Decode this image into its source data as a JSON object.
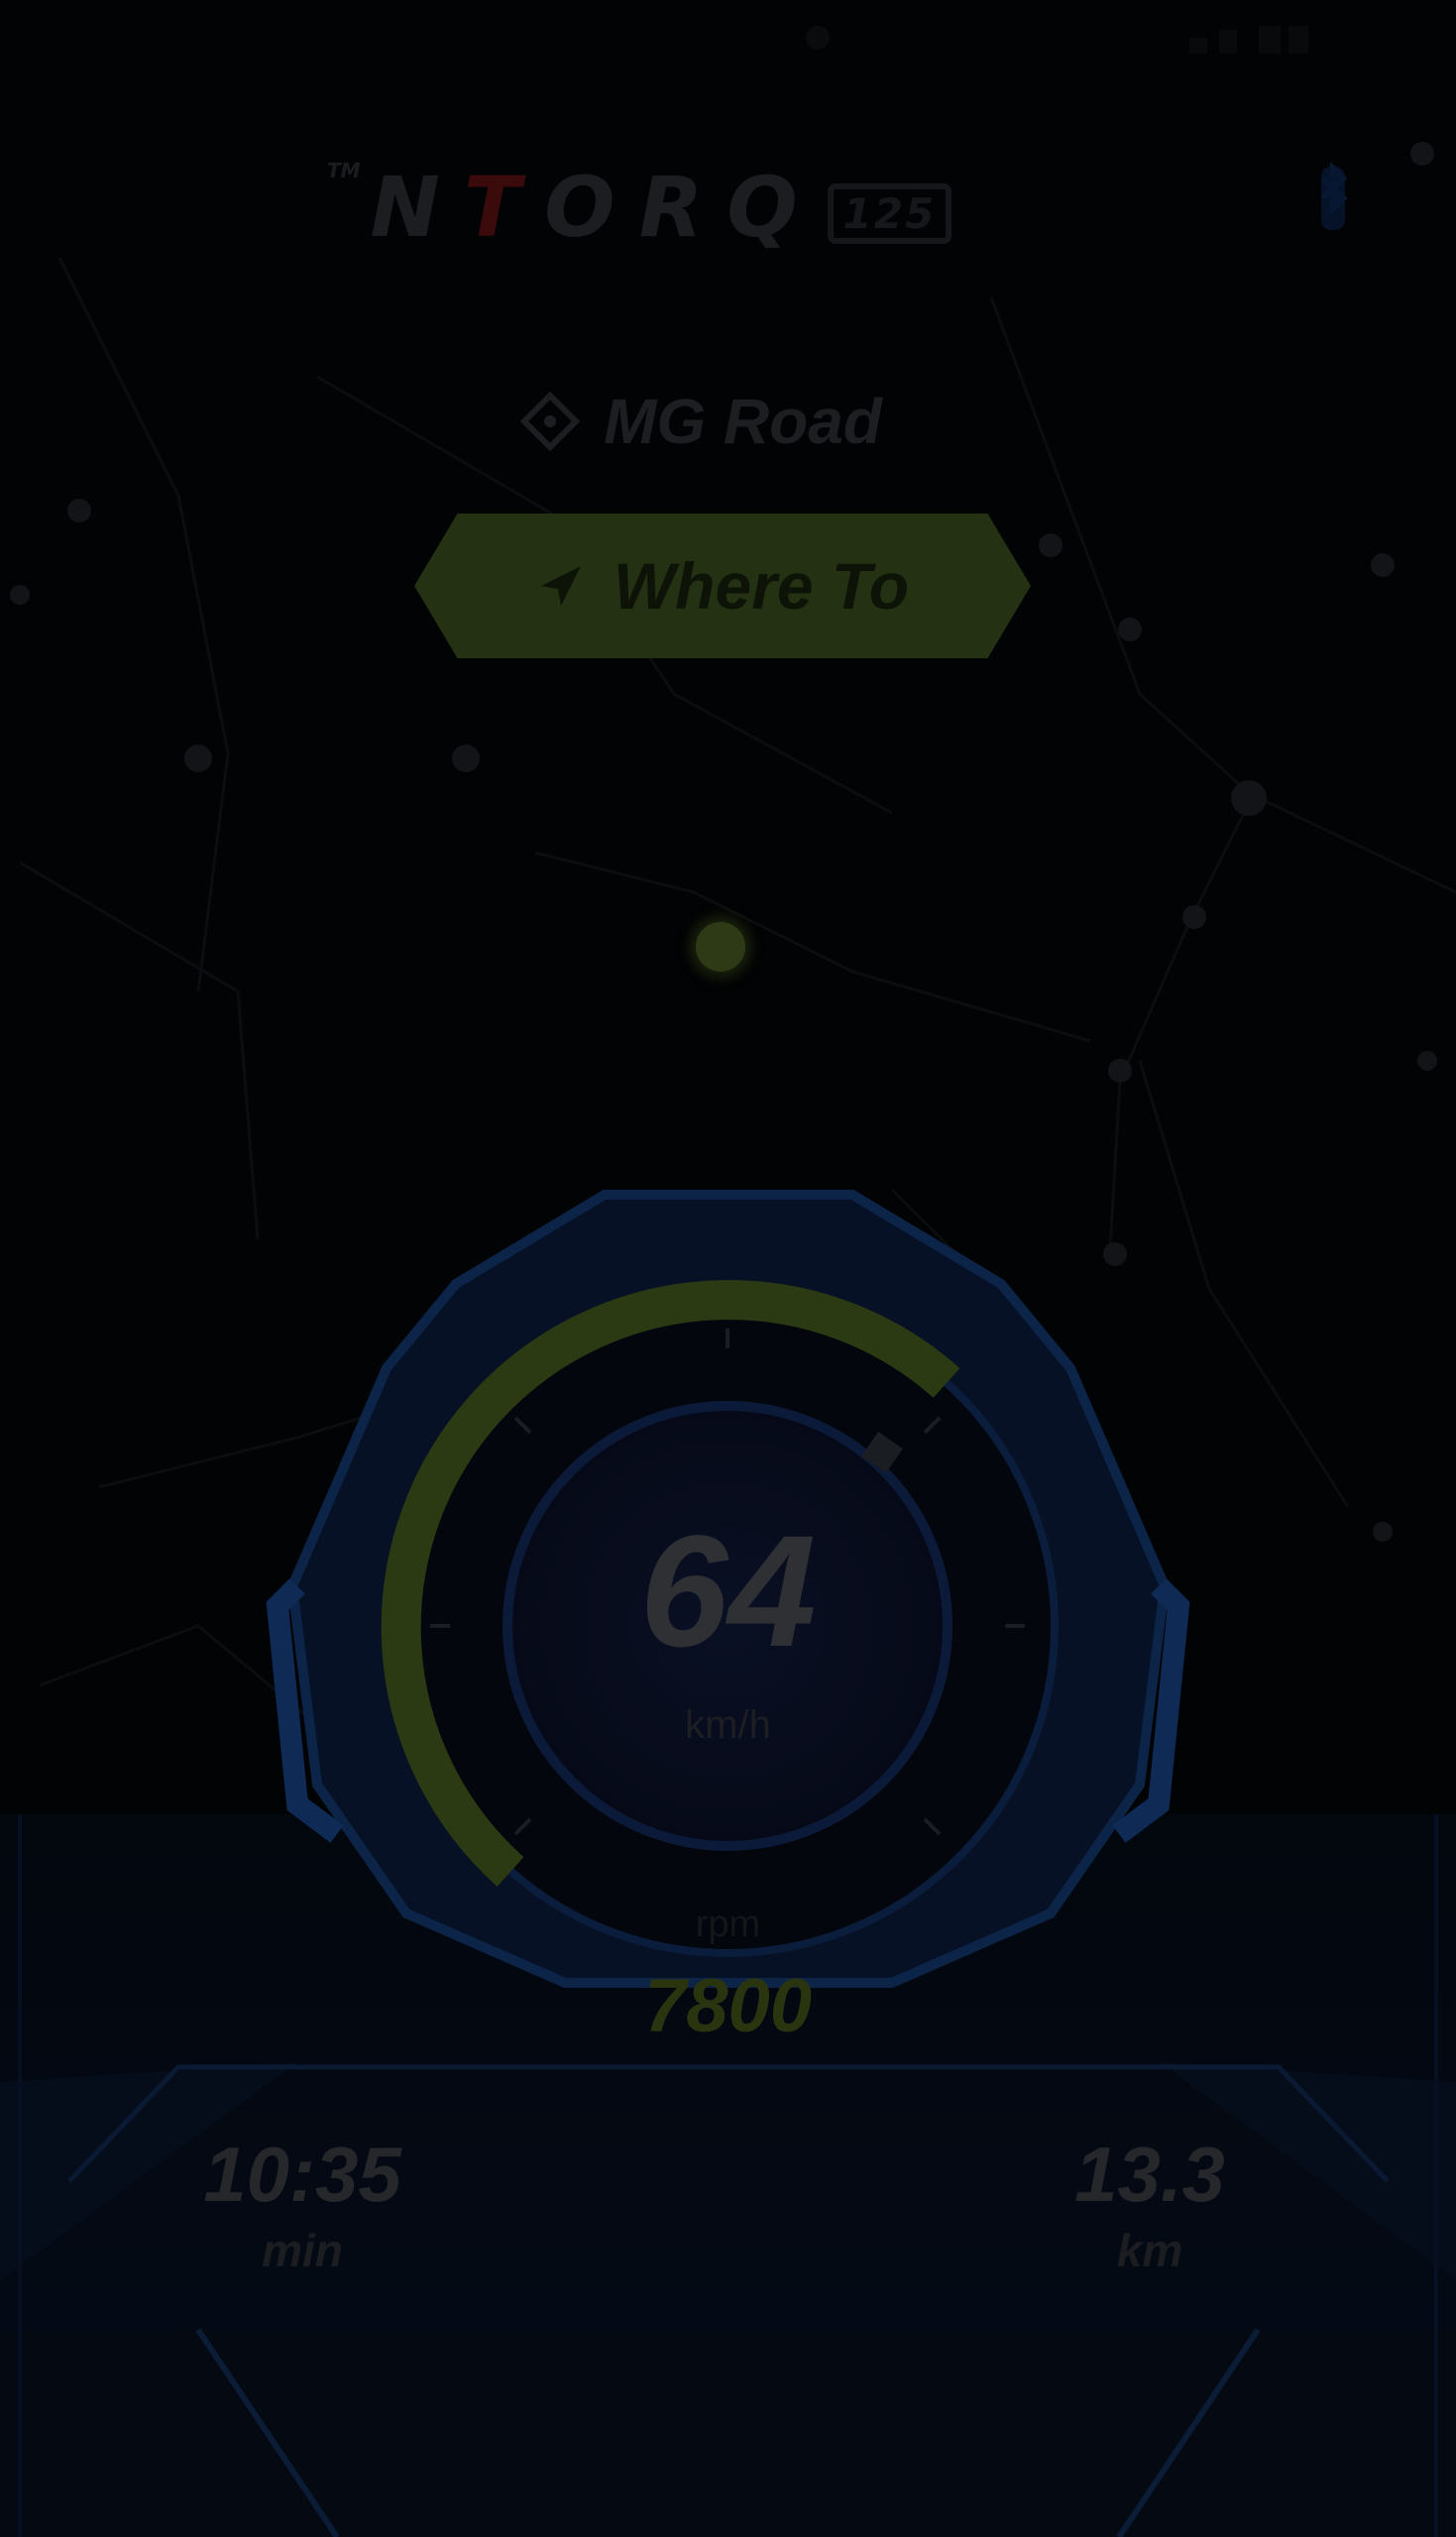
{
  "brand": {
    "tm": "TM",
    "part1": "N",
    "part2": "T",
    "part3": "ORQ",
    "suffix": "125"
  },
  "location": {
    "name": "MG Road"
  },
  "where_to": {
    "label": "Where To"
  },
  "speedometer": {
    "speed": "64",
    "unit": "km/h",
    "rpm_label": "rpm",
    "rpm": "7800",
    "rpm_level": 0.6
  },
  "stats": {
    "time_value": "10:35",
    "time_unit": "min",
    "distance_value": "13.3",
    "distance_unit": "km"
  },
  "colors": {
    "accent_green": "#2c3a13",
    "frame_blue": "#0c2447",
    "background": "#020304"
  }
}
